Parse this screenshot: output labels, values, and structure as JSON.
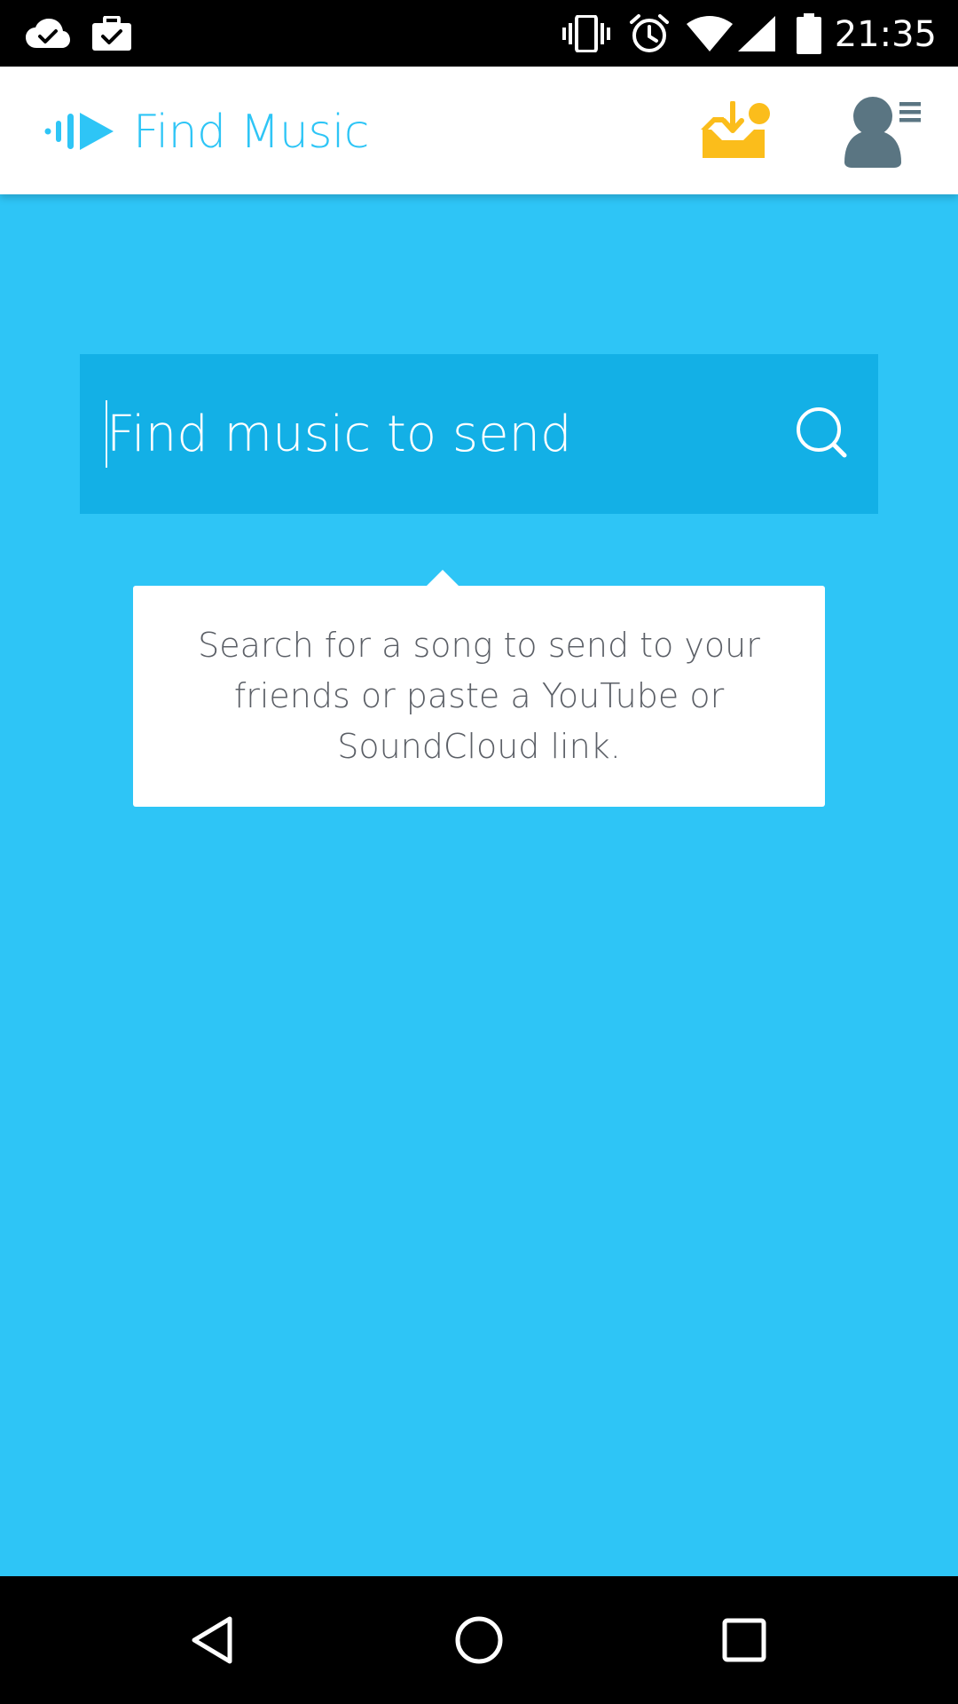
{
  "status_bar": {
    "time": "21:35",
    "icons": [
      "cloud-check-icon",
      "briefcase-check-icon",
      "vibrate-icon",
      "alarm-icon",
      "wifi-icon",
      "cell-signal-icon",
      "battery-icon"
    ]
  },
  "app_bar": {
    "title": "Find Music",
    "logo_icon": "play-wave-logo-icon",
    "inbox_icon": "inbox-download-icon",
    "profile_icon": "profile-menu-icon"
  },
  "search": {
    "placeholder": "Find music to send",
    "value": "",
    "icon": "search-icon"
  },
  "tooltip": {
    "text": "Search for a song to send to your friends or paste a YouTube or SoundCloud link."
  },
  "nav_bar": {
    "buttons": [
      "back-icon",
      "home-icon",
      "recents-icon"
    ]
  },
  "colors": {
    "accent": "#2ec5f6",
    "search_bg": "#13b0e6",
    "inbox_icon": "#fbbd1b",
    "profile_icon": "#5a7582",
    "tooltip_text": "#5b5f66"
  }
}
